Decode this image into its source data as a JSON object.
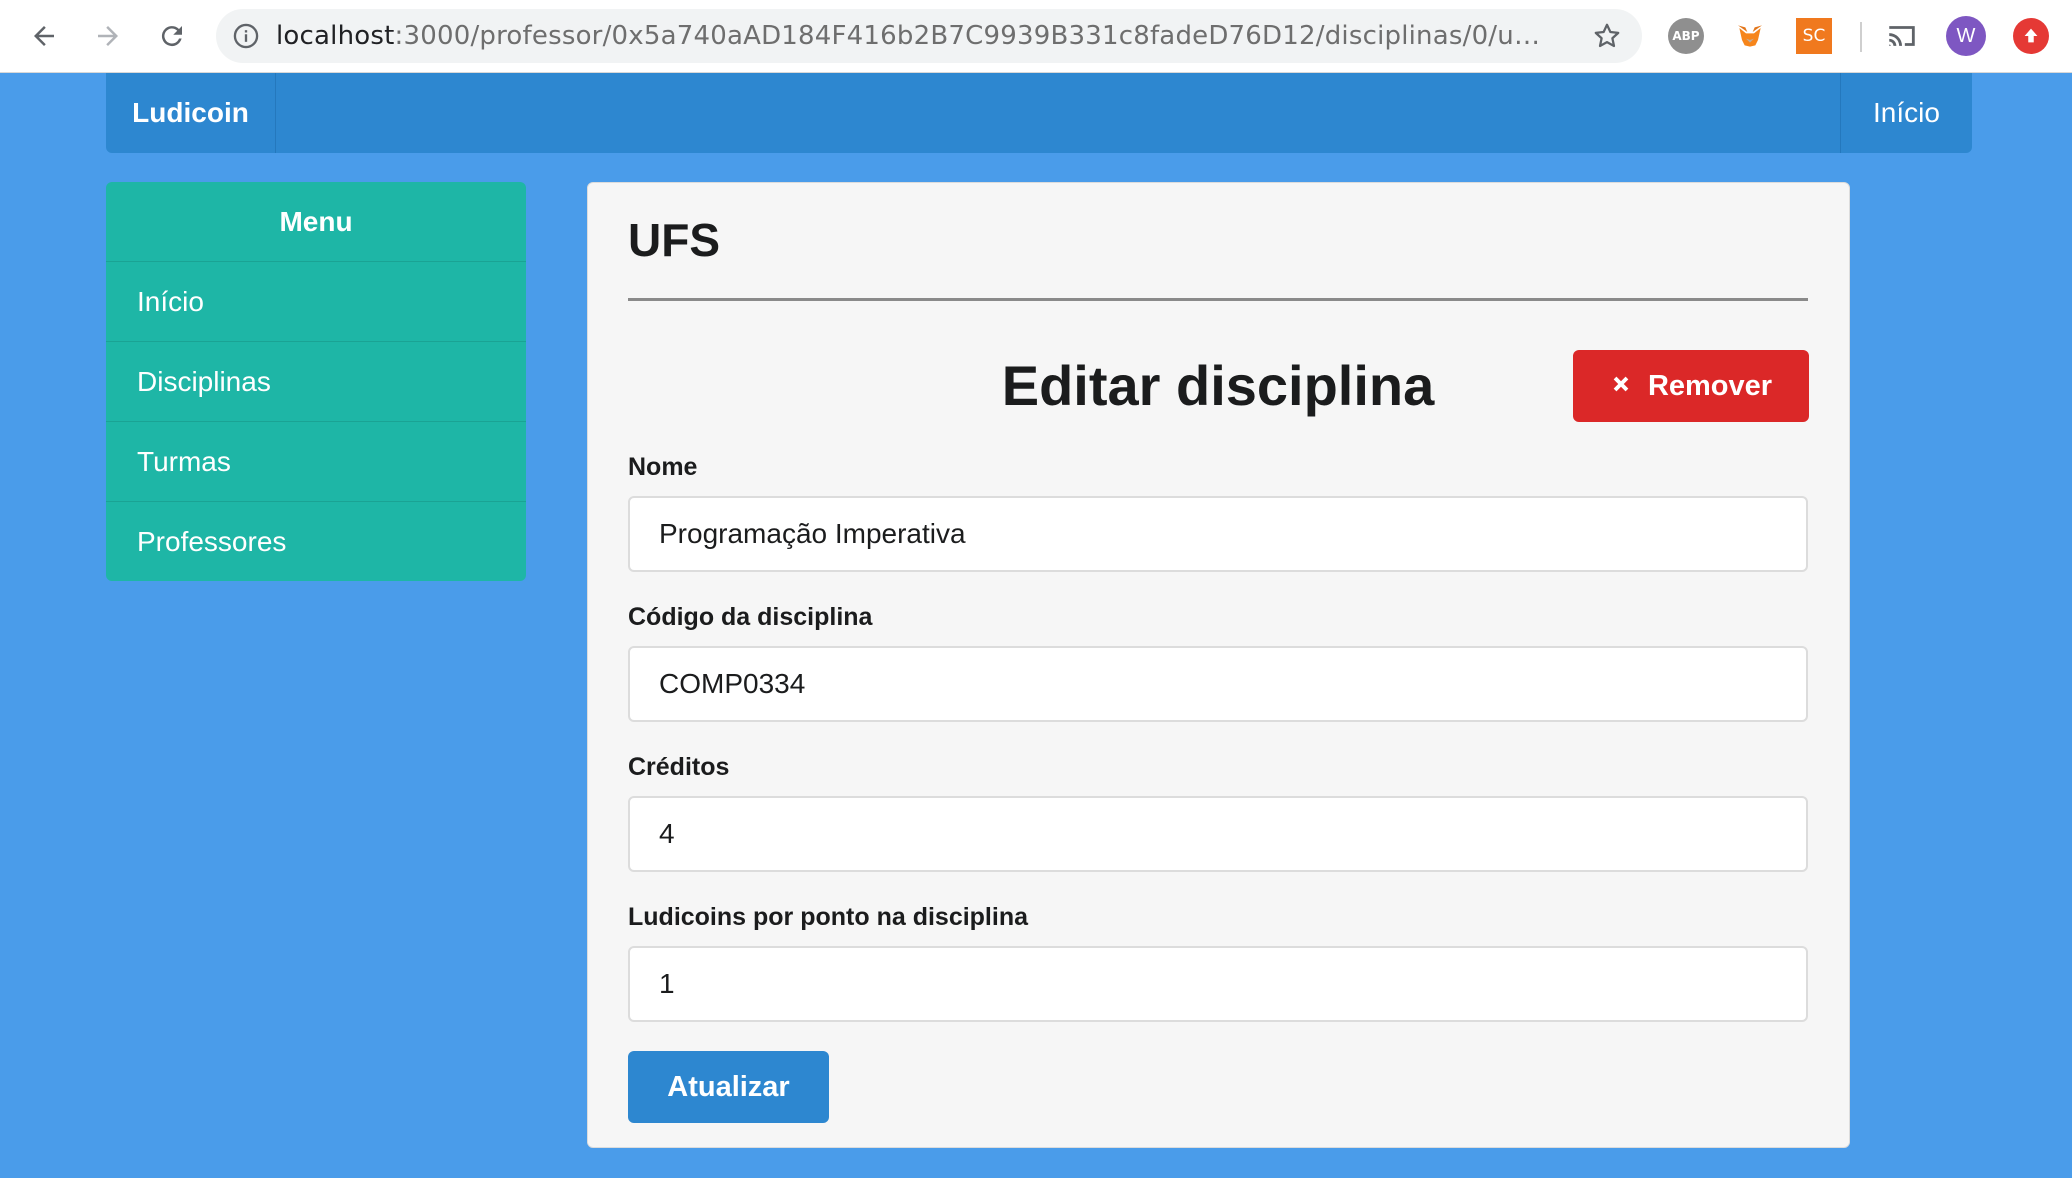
{
  "browser": {
    "url_host": "localhost",
    "url_path": ":3000/professor/0x5a740aAD184F416b2B7C9939B331c8fadeD76D12/disciplinas/0/u…",
    "extensions": {
      "abp_label": "ABP",
      "sc_label": "SC",
      "profile_initial": "W"
    }
  },
  "navbar": {
    "brand": "Ludicoin",
    "home_link": "Início"
  },
  "sidebar": {
    "title": "Menu",
    "items": [
      {
        "label": "Início"
      },
      {
        "label": "Disciplinas"
      },
      {
        "label": "Turmas"
      },
      {
        "label": "Professores"
      }
    ]
  },
  "main": {
    "institution": "UFS",
    "form_title": "Editar disciplina",
    "remove_label": "Remover",
    "fields": [
      {
        "label": "Nome",
        "value": "Programação Imperativa"
      },
      {
        "label": "Código da disciplina",
        "value": "COMP0334"
      },
      {
        "label": "Créditos",
        "value": "4"
      },
      {
        "label": "Ludicoins por ponto na disciplina",
        "value": "1"
      }
    ],
    "submit_label": "Atualizar"
  },
  "colors": {
    "page_bg": "#4a9cea",
    "navbar": "#2d87d0",
    "sidebar": "#1eb6a6",
    "danger": "#db2828",
    "primary": "#2d87d0"
  }
}
